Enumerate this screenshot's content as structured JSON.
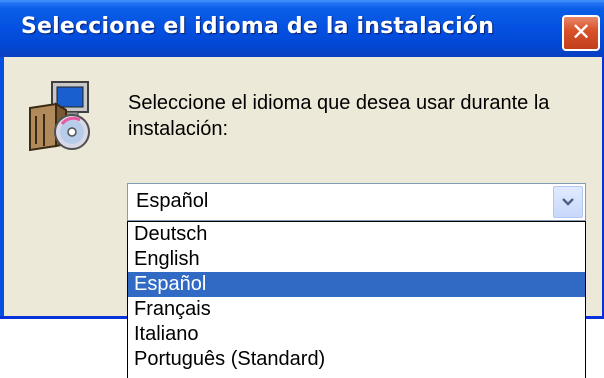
{
  "window": {
    "title": "Seleccione el idioma de la instalación",
    "close_glyph": "✕"
  },
  "dialog": {
    "icon": "installer-cd-icon",
    "message": "Seleccione el idioma que desea usar durante la instalación:"
  },
  "language_select": {
    "value": "Español",
    "options": [
      {
        "label": "Deutsch",
        "selected": false
      },
      {
        "label": "English",
        "selected": false
      },
      {
        "label": "Español",
        "selected": true
      },
      {
        "label": "Français",
        "selected": false
      },
      {
        "label": "Italiano",
        "selected": false
      },
      {
        "label": "Português (Standard)",
        "selected": false
      }
    ]
  },
  "colors": {
    "titlebar": "#0450e1",
    "dialog_bg": "#ece9d8",
    "highlight": "#316ac5",
    "close": "#d9532c"
  }
}
